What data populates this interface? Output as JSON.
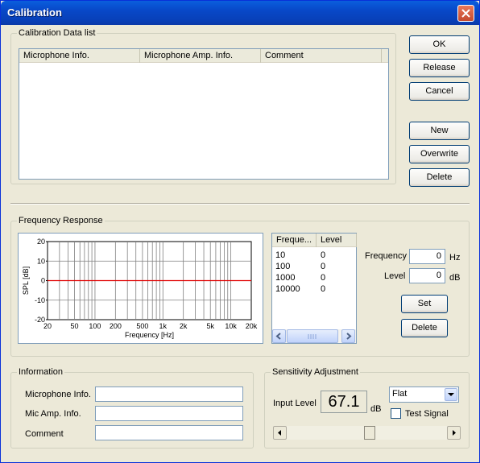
{
  "window": {
    "title": "Calibration"
  },
  "calibration_list": {
    "legend": "Calibration Data list",
    "columns": [
      "Microphone Info.",
      "Microphone Amp. Info.",
      "Comment"
    ],
    "rows": []
  },
  "buttons": {
    "ok": "OK",
    "release": "Release",
    "cancel": "Cancel",
    "new": "New",
    "overwrite": "Overwrite",
    "delete": "Delete",
    "set": "Set",
    "delete2": "Delete"
  },
  "frequency_response": {
    "legend": "Frequency Response",
    "table": {
      "columns": [
        "Freque...",
        "Level"
      ],
      "rows": [
        {
          "freq": "10",
          "level": "0"
        },
        {
          "freq": "100",
          "level": "0"
        },
        {
          "freq": "1000",
          "level": "0"
        },
        {
          "freq": "10000",
          "level": "0"
        }
      ]
    },
    "frequency_label": "Frequency",
    "frequency_value": "0",
    "frequency_unit": "Hz",
    "level_label": "Level",
    "level_value": "0",
    "level_unit": "dB"
  },
  "chart_data": {
    "type": "line",
    "xscale": "log",
    "xlim": [
      20,
      20000
    ],
    "ylim": [
      -20,
      20
    ],
    "xticks": [
      "20",
      "50",
      "100",
      "200",
      "500",
      "1k",
      "2k",
      "5k",
      "10k",
      "20k"
    ],
    "xtick_values": [
      20,
      50,
      100,
      200,
      500,
      1000,
      2000,
      5000,
      10000,
      20000
    ],
    "yticks": [
      "20",
      "10",
      "0",
      "-10",
      "-20"
    ],
    "ytick_values": [
      20,
      10,
      0,
      -10,
      -20
    ],
    "xlabel": "Frequency [Hz]",
    "ylabel": "SPL [dB]",
    "grid": true,
    "series": [
      {
        "x": [
          20,
          20000
        ],
        "y": [
          0,
          0
        ],
        "color": "#e00000"
      }
    ]
  },
  "information": {
    "legend": "Information",
    "microphone_label": "Microphone Info.",
    "mic_amp_label": "Mic Amp. Info.",
    "comment_label": "Comment",
    "microphone_value": "",
    "mic_amp_value": "",
    "comment_value": ""
  },
  "sensitivity": {
    "legend": "Sensitivity Adjustment",
    "input_level_label": "Input Level",
    "input_level_value": "67.1",
    "unit": "dB",
    "mode": "Flat",
    "test_signal_label": "Test Signal",
    "test_signal_checked": false,
    "slider_position": 0.52
  },
  "colors": {
    "title_bar": "#0a5fdd",
    "curve": "#e00000"
  }
}
